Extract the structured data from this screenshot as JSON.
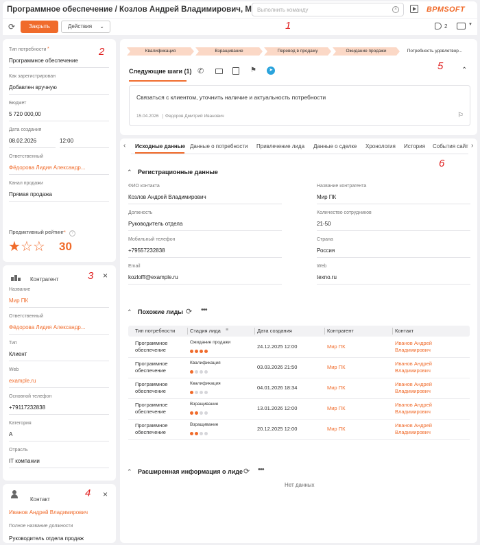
{
  "header": {
    "title": "Программное обеспечение / Козлов Андрей Владимирович, Мир ПК",
    "command_placeholder": "Выполнить команду",
    "logo": "BPMSOFT"
  },
  "toolbar": {
    "close_label": "Закрыть",
    "actions_label": "Действия",
    "tag_count": "2"
  },
  "left": {
    "fields": [
      {
        "label": "Тип потребности",
        "value": "Программное обеспечение"
      },
      {
        "label": "Как зарегистрирован",
        "value": "Добавлен вручную"
      },
      {
        "label": "Бюджет",
        "value": "5 720 000,00"
      },
      {
        "label": "Дата создания",
        "value": "08.02.2026",
        "value2": "12:00"
      },
      {
        "label": "Ответственный",
        "value": "Фёдорова Лидия Александр..."
      },
      {
        "label": "Канал продажи",
        "value": "Прямая продажа"
      }
    ],
    "rating_label": "Предиктивный рейтинг",
    "rating_value": "30",
    "rating_stars": 1
  },
  "account": {
    "title": "Контрагент",
    "fields": [
      {
        "label": "Название",
        "value": "Мир ПК"
      },
      {
        "label": "Ответственный",
        "value": "Фёдорова Лидия Александр..."
      },
      {
        "label": "Тип",
        "value": "Клиент"
      },
      {
        "label": "Web",
        "value": "example.ru"
      },
      {
        "label": "Основной телефон",
        "value": "+79117232838"
      },
      {
        "label": "Категория",
        "value": "A"
      },
      {
        "label": "Отрасль",
        "value": "IT компании"
      }
    ]
  },
  "contact": {
    "title": "Контакт",
    "name": "Иванов Андрей Владимирович",
    "job_label": "Полное название должности",
    "job_value": "Руководитель отдела продаж"
  },
  "stages": [
    "Квалификация",
    "Взращивание",
    "Перевод в продажу",
    "Ожидание продажи",
    "Потребность удовлетвор..."
  ],
  "next_steps": {
    "title": "Следующие шаги (1)",
    "task_text": "Связаться с клиентом, уточнить наличие и актуальность потребности",
    "task_date": "15.04.2026",
    "task_owner": "Федоров Дмитрий Иванович"
  },
  "tabs": [
    "Исходные данные",
    "Данные о потребности",
    "Привлечение лида",
    "Данные о сделке",
    "Хронология",
    "История",
    "События сайта"
  ],
  "reg": {
    "title": "Регистрационные данные",
    "fields": [
      {
        "label": "ФИО контакта",
        "value": "Козлов Андрей Владимирович"
      },
      {
        "label": "Название контрагента",
        "value": "Мир ПК"
      },
      {
        "label": "Должность",
        "value": "Руководитель отдела"
      },
      {
        "label": "Количество сотрудников",
        "value": "21-50"
      },
      {
        "label": "Мобильный телефон",
        "value": "+79557232838"
      },
      {
        "label": "Страна",
        "value": "Россия"
      },
      {
        "label": "Email",
        "value": "kozlofff@example.ru"
      },
      {
        "label": "Web",
        "value": "texno.ru"
      }
    ]
  },
  "similar": {
    "title": "Похожие лиды",
    "headers": [
      "Тип потребности",
      "Стадия лида",
      "Дата создания",
      "Контрагент",
      "Контакт"
    ],
    "rows": [
      {
        "type1": "Программное",
        "type2": "обеспечение",
        "stage": "Ожидание продажи",
        "dots": 4,
        "date": "24.12.2025 12:00",
        "account": "Мир ПК",
        "contact1": "Иванов Андрей",
        "contact2": "Владимирович"
      },
      {
        "type1": "Программное",
        "type2": "обеспечение",
        "stage": "Квалификация",
        "dots": 1,
        "date": "03.03.2026 21:50",
        "account": "Мир ПК",
        "contact1": "Иванов Андрей",
        "contact2": "Владимирович"
      },
      {
        "type1": "Программное",
        "type2": "обеспечение",
        "stage": "Квалификация",
        "dots": 1,
        "date": "04.01.2026 18:34",
        "account": "Мир ПК",
        "contact1": "Иванов Андрей",
        "contact2": "Владимирович"
      },
      {
        "type1": "Программное",
        "type2": "обеспечение",
        "stage": "Взращивание",
        "dots": 2,
        "date": "13.01.2026 12:00",
        "account": "Мир ПК",
        "contact1": "Иванов Андрей",
        "contact2": "Владимирович"
      },
      {
        "type1": "Программное",
        "type2": "обеспечение",
        "stage": "Взращивание",
        "dots": 2,
        "date": "20.12.2025 12:00",
        "account": "Мир ПК",
        "contact1": "Иванов Андрей",
        "contact2": "Владимирович"
      }
    ]
  },
  "extended": {
    "title": "Расширенная информация о лиде",
    "empty": "Нет данных"
  },
  "markers": [
    "1",
    "2",
    "3",
    "4",
    "5",
    "6"
  ]
}
